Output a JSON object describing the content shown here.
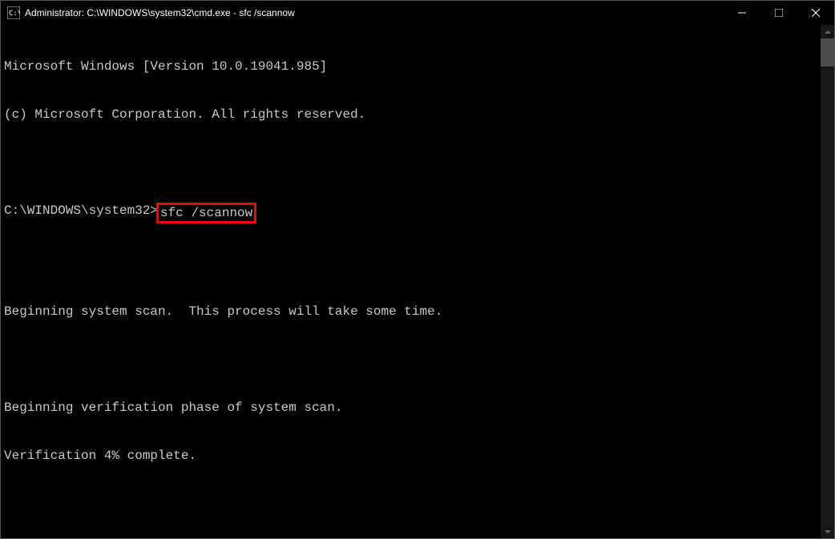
{
  "titlebar": {
    "title": "Administrator: C:\\WINDOWS\\system32\\cmd.exe - sfc  /scannow"
  },
  "terminal": {
    "line1": "Microsoft Windows [Version 10.0.19041.985]",
    "line2": "(c) Microsoft Corporation. All rights reserved.",
    "blank1": "",
    "prompt": "C:\\WINDOWS\\system32>",
    "command": "sfc /scannow",
    "blank2": "",
    "line3": "Beginning system scan.  This process will take some time.",
    "blank3": "",
    "line4": "Beginning verification phase of system scan.",
    "line5": "Verification 4% complete."
  }
}
